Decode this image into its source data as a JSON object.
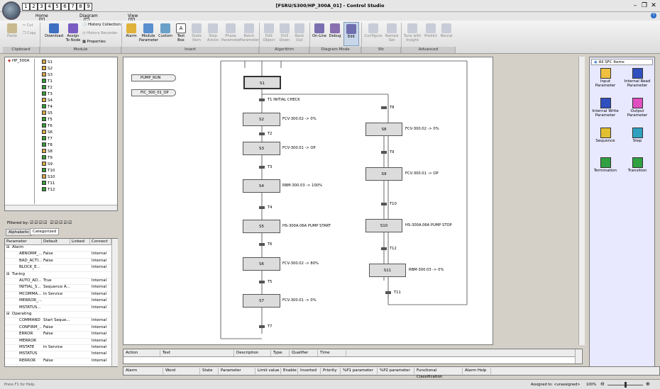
{
  "window": {
    "title": "[FSRU/S300/HP_300A_01] - Control Studio",
    "minimize": "–",
    "restore": "❐",
    "close": "✕",
    "help": "?"
  },
  "qat": [
    "1",
    "2",
    "3",
    "4",
    "5",
    "6",
    "7",
    "8",
    "9"
  ],
  "tabs": [
    {
      "label": "Home",
      "keytip": "H"
    },
    {
      "label": "Diagram",
      "keytip": "G"
    },
    {
      "label": "View",
      "keytip": "W"
    }
  ],
  "ribbon": {
    "clipboard": {
      "label": "Clipboard",
      "paste": "Paste",
      "cut": "Cut",
      "copy": "Copy"
    },
    "module": {
      "label": "Module",
      "download": "Download",
      "assign": "Assign\nTo Node",
      "history_collection": "History Collection",
      "history_recorder": "History Recorder",
      "properties": "Properties"
    },
    "insert": {
      "label": "Insert",
      "alarm": "Alarm",
      "module_parameter": "Module\nParameter",
      "custom": "Custom",
      "text_box": "Text\nBox",
      "state_item": "State\nItem",
      "step_action": "Step\nAction",
      "phase_parameter": "Phase\nParameter",
      "batch_parameter": "Batch\nParameter"
    },
    "algorithm": {
      "label": "Algorithm",
      "edit_object": "Edit\nObject",
      "drill_down": "Drill\nDown",
      "back_out": "Back\nOut"
    },
    "diagram_mode": {
      "label": "Diagram Mode",
      "online": "On-Line",
      "debug": "Debug",
      "edit": "Edit"
    },
    "sfc": {
      "label": "Sfc",
      "configure": "Configure",
      "named_set": "Named\nSet"
    },
    "advanced": {
      "label": "Advanced",
      "tune": "Tune with\nInsight",
      "predict": "Predict",
      "neural": "Neural"
    }
  },
  "tree": {
    "root": "HP_300A",
    "items": [
      "S1",
      "S2",
      "S3",
      "T1",
      "T2",
      "T3",
      "S4",
      "T4",
      "S5",
      "T5",
      "T6",
      "S6",
      "T7",
      "T8",
      "S8",
      "T9",
      "S9",
      "T10",
      "S10",
      "T11",
      "T12"
    ]
  },
  "filter": {
    "label": "Filtered by:",
    "tabs": [
      "Alphabetic",
      "Categorized"
    ]
  },
  "props": {
    "headers": [
      "Parameter",
      "Default",
      "Linked",
      "Connect"
    ],
    "rows": [
      {
        "type": "group",
        "name": "Alarm"
      },
      {
        "name": "ABNORM_...",
        "default": "False",
        "linked": "",
        "connect": "Internal"
      },
      {
        "name": "BAD_ACTI...",
        "default": "False",
        "linked": "",
        "connect": "Internal"
      },
      {
        "name": "BLOCK_E...",
        "default": "",
        "linked": "",
        "connect": "Internal"
      },
      {
        "type": "group",
        "name": "Tuning"
      },
      {
        "name": "AUTO_AD...",
        "default": "True",
        "linked": "",
        "connect": "Internal"
      },
      {
        "name": "INITIAL_S...",
        "default": "Sequence A...",
        "linked": "",
        "connect": "Internal"
      },
      {
        "name": "MCOMMA...",
        "default": "In Service",
        "linked": "",
        "connect": "Internal"
      },
      {
        "name": "MERROR_...",
        "default": "",
        "linked": "",
        "connect": "Internal"
      },
      {
        "name": "MSTATUS...",
        "default": "",
        "linked": "",
        "connect": "Internal"
      },
      {
        "type": "group",
        "name": "Operating"
      },
      {
        "name": "COMMAND",
        "default": "Start Seque...",
        "linked": "",
        "connect": "Internal"
      },
      {
        "name": "CONFIRM_...",
        "default": "False",
        "linked": "",
        "connect": "Internal"
      },
      {
        "name": "ERROR",
        "default": "False",
        "linked": "",
        "connect": "Internal"
      },
      {
        "name": "MERROR",
        "default": "",
        "linked": "",
        "connect": "Internal"
      },
      {
        "name": "MSTATE",
        "default": "In Service",
        "linked": "",
        "connect": "Internal"
      },
      {
        "name": "MSTATUS",
        "default": "",
        "linked": "",
        "connect": "Internal"
      },
      {
        "name": "RERROR",
        "default": "False",
        "linked": "",
        "connect": "Internal"
      }
    ]
  },
  "diagram": {
    "params": [
      "PUMP_RUN",
      "FIC_300_01_OP"
    ],
    "steps": [
      {
        "id": "S1",
        "action": ""
      },
      {
        "id": "S2",
        "action": "FCV-300.02 -> 0%"
      },
      {
        "id": "S3",
        "action": "FCV-300.01 -> OP"
      },
      {
        "id": "S4",
        "action": "RBM-300.03 -> 100%"
      },
      {
        "id": "S5",
        "action": "HS-300A.06A PUMP START"
      },
      {
        "id": "S6",
        "action": "FCV-300.02 -> 80%"
      },
      {
        "id": "S7",
        "action": "FCV-300.01 -> 0%"
      },
      {
        "id": "S8",
        "action": "FCV-300.02 -> 0%"
      },
      {
        "id": "S9",
        "action": "FCV-300.01 -> OP"
      },
      {
        "id": "S10",
        "action": "HS-300A.06A PUMP STOP"
      },
      {
        "id": "S11",
        "action": "RBM-300.03 -> 0%"
      }
    ],
    "transitions": [
      {
        "id": "T1",
        "label": "INITIAL CHECK"
      },
      {
        "id": "T2",
        "label": ""
      },
      {
        "id": "T3",
        "label": ""
      },
      {
        "id": "T4",
        "label": ""
      },
      {
        "id": "T5",
        "label": ""
      },
      {
        "id": "T6",
        "label": ""
      },
      {
        "id": "T7",
        "label": ""
      },
      {
        "id": "T8",
        "label": ""
      },
      {
        "id": "T9",
        "label": ""
      },
      {
        "id": "T10",
        "label": ""
      },
      {
        "id": "T11",
        "label": ""
      },
      {
        "id": "T12",
        "label": ""
      }
    ]
  },
  "palette": {
    "title": "All SFC Items",
    "items": [
      "Input\nParameter",
      "Internal Read\nParameter",
      "Internal Write\nParameter",
      "Output\nParameter",
      "Sequence",
      "Step",
      "Termination",
      "Transition"
    ]
  },
  "action_grid": {
    "headers": [
      "Action",
      "Text",
      "Description",
      "Type",
      "Qualifier",
      "Time"
    ]
  },
  "alarm_grid": {
    "headers": [
      "Alarm",
      "Word",
      "State",
      "Parameter",
      "Limit value",
      "Enable",
      "Inverted",
      "Priority",
      "%P1 parameter",
      "%P2 parameter",
      "Functional Classification",
      "Alarm Help"
    ]
  },
  "status": {
    "help": "Press F1 for Help.",
    "assigned": "Assigned to: <unassigned>",
    "zoom": "100%"
  }
}
